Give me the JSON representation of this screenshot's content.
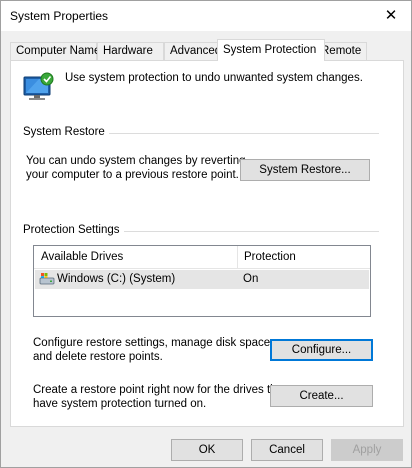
{
  "window": {
    "title": "System Properties"
  },
  "tabs": [
    {
      "label": "Computer Name"
    },
    {
      "label": "Hardware"
    },
    {
      "label": "Advanced"
    },
    {
      "label": "System Protection",
      "active": true
    },
    {
      "label": "Remote"
    }
  ],
  "intro": {
    "text": "Use system protection to undo unwanted system changes."
  },
  "system_restore": {
    "group_title": "System Restore",
    "desc_line1": "You can undo system changes by reverting",
    "desc_line2": "your computer to a previous restore point.",
    "button_label": "System Restore..."
  },
  "protection": {
    "group_title": "Protection Settings",
    "columns": [
      "Available Drives",
      "Protection"
    ],
    "rows": [
      {
        "drive": "Windows (C:) (System)",
        "protection": "On"
      }
    ],
    "configure_line1": "Configure restore settings, manage disk space,",
    "configure_line2": "and delete restore points.",
    "configure_label": "Configure...",
    "create_line1": "Create a restore point right now for the drives that",
    "create_line2": "have system protection turned on.",
    "create_label": "Create..."
  },
  "footer": {
    "ok": "OK",
    "cancel": "Cancel",
    "apply": "Apply"
  },
  "icons": {
    "close": "close-icon",
    "system_protection": "system-protection-icon",
    "drive": "system-drive-icon"
  },
  "colors": {
    "focus": "#0078d7",
    "button_bg": "#e1e1e1",
    "panel": "#ffffff",
    "chrome": "#f0f0f0"
  }
}
